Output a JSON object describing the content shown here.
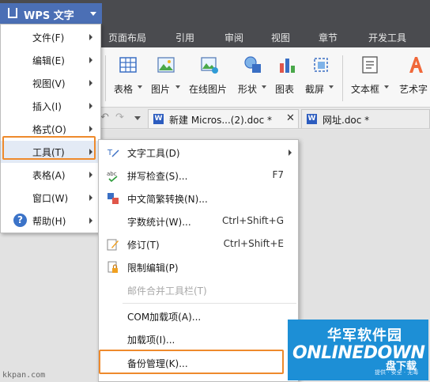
{
  "app": {
    "title": "WPS 文字"
  },
  "ribbon_tabs": [
    "页面布局",
    "引用",
    "审阅",
    "视图",
    "章节",
    "开发工具"
  ],
  "toolbar": {
    "items": [
      {
        "label": "表格",
        "icon": "table-icon"
      },
      {
        "label": "图片",
        "icon": "picture-icon"
      },
      {
        "label": "在线图片",
        "icon": "online-picture-icon"
      },
      {
        "label": "形状",
        "icon": "shape-icon"
      },
      {
        "label": "图表",
        "icon": "chart-icon"
      },
      {
        "label": "截屏",
        "icon": "screenshot-icon"
      },
      {
        "label": "文本框",
        "icon": "textbox-icon"
      },
      {
        "label": "艺术字",
        "icon": "wordart-icon"
      }
    ]
  },
  "doc_tabs": [
    {
      "label": "新建 Micros...(2).doc *",
      "badge": "W"
    },
    {
      "label": "网址.doc *",
      "badge": "W"
    }
  ],
  "main_menu": {
    "items": [
      {
        "label": "文件(F)"
      },
      {
        "label": "编辑(E)"
      },
      {
        "label": "视图(V)"
      },
      {
        "label": "插入(I)"
      },
      {
        "label": "格式(O)"
      },
      {
        "label": "工具(T)"
      },
      {
        "label": "表格(A)"
      },
      {
        "label": "窗口(W)"
      },
      {
        "label": "帮助(H)"
      }
    ]
  },
  "tools_menu": {
    "items": [
      {
        "label": "文字工具(D)",
        "shortcut": "",
        "icon": "text-tools-icon"
      },
      {
        "label": "拼写检查(S)...",
        "shortcut": "F7",
        "icon": "spellcheck-icon"
      },
      {
        "label": "中文简繁转换(N)...",
        "shortcut": "",
        "icon": "chinese-convert-icon"
      },
      {
        "label": "字数统计(W)...",
        "shortcut": "Ctrl+Shift+G",
        "icon": ""
      },
      {
        "label": "修订(T)",
        "shortcut": "Ctrl+Shift+E",
        "icon": "track-changes-icon"
      },
      {
        "label": "限制编辑(P)",
        "shortcut": "",
        "icon": "restrict-edit-icon"
      },
      {
        "label": "邮件合并工具栏(T)",
        "shortcut": "",
        "icon": ""
      },
      {
        "label": "COM加载项(A)...",
        "shortcut": "",
        "icon": ""
      },
      {
        "label": "加载项(I)...",
        "shortcut": "",
        "icon": ""
      },
      {
        "label": "备份管理(K)...",
        "shortcut": "",
        "icon": ""
      }
    ]
  },
  "watermark": {
    "site_small": "kkpan.com",
    "logo_cn": "华军软件园",
    "logo_en": "ONLINEDOWN",
    "logo_badge": "盘下载",
    "logo_small": "提供 · 安全 · 无毒"
  },
  "colors": {
    "app_button": "#4b6fb5",
    "highlight": "#ee8a2c",
    "ribbon_bg": "#4a4b4f"
  }
}
